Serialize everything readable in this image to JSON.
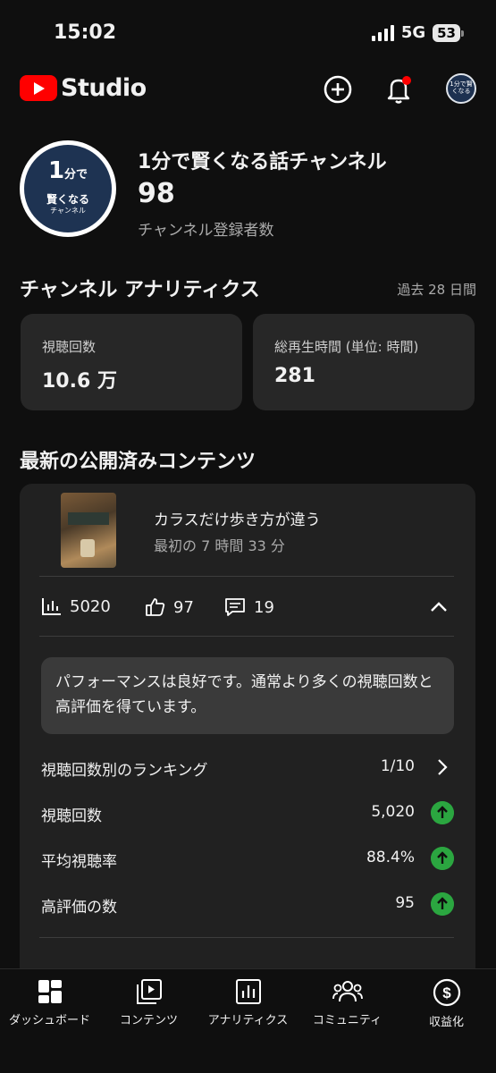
{
  "status_bar": {
    "time": "15:02",
    "network": "5G",
    "battery": "53"
  },
  "header": {
    "app_name": "Studio",
    "create_icon": "add-circle-icon",
    "notifications_icon": "bell-icon",
    "avatar_text": "1分で賢くなる"
  },
  "channel": {
    "avatar_big": "1",
    "avatar_big_suffix": "分で",
    "avatar_mid": "賢くなる",
    "avatar_sub": "チャンネル",
    "name": "1分で賢くなる話チャンネル",
    "subscribers": "98",
    "subscribers_label": "チャンネル登録者数"
  },
  "analytics": {
    "title": "チャンネル アナリティクス",
    "period": "過去 28 日間",
    "cards": [
      {
        "label": "視聴回数",
        "value": "10.6 万"
      },
      {
        "label": "総再生時間 (単位: 時間)",
        "value": "281"
      }
    ]
  },
  "latest": {
    "title": "最新の公開済みコンテンツ",
    "video_title": "カラスだけ歩き方が違う",
    "video_period": "最初の 7 時間 33 分",
    "views": "5020",
    "likes": "97",
    "comments": "19",
    "performance_message": "パフォーマンスは良好です。通常より多くの視聴回数と高評価を得ています。",
    "rows": [
      {
        "label": "視聴回数別のランキング",
        "value": "1/10"
      },
      {
        "label": "視聴回数",
        "value": "5,020"
      },
      {
        "label": "平均視聴率",
        "value": "88.4%"
      },
      {
        "label": "高評価の数",
        "value": "95"
      }
    ]
  },
  "bottom_nav": [
    {
      "label": "ダッシュボード",
      "icon": "dashboard-icon"
    },
    {
      "label": "コンテンツ",
      "icon": "content-icon"
    },
    {
      "label": "アナリティクス",
      "icon": "analytics-icon"
    },
    {
      "label": "コミュニティ",
      "icon": "community-icon"
    },
    {
      "label": "収益化",
      "icon": "monetization-icon"
    }
  ],
  "colors": {
    "accent_red": "#ff0000",
    "up_green": "#2ba640",
    "card_bg": "#272727",
    "bg": "#0f0f0f"
  }
}
